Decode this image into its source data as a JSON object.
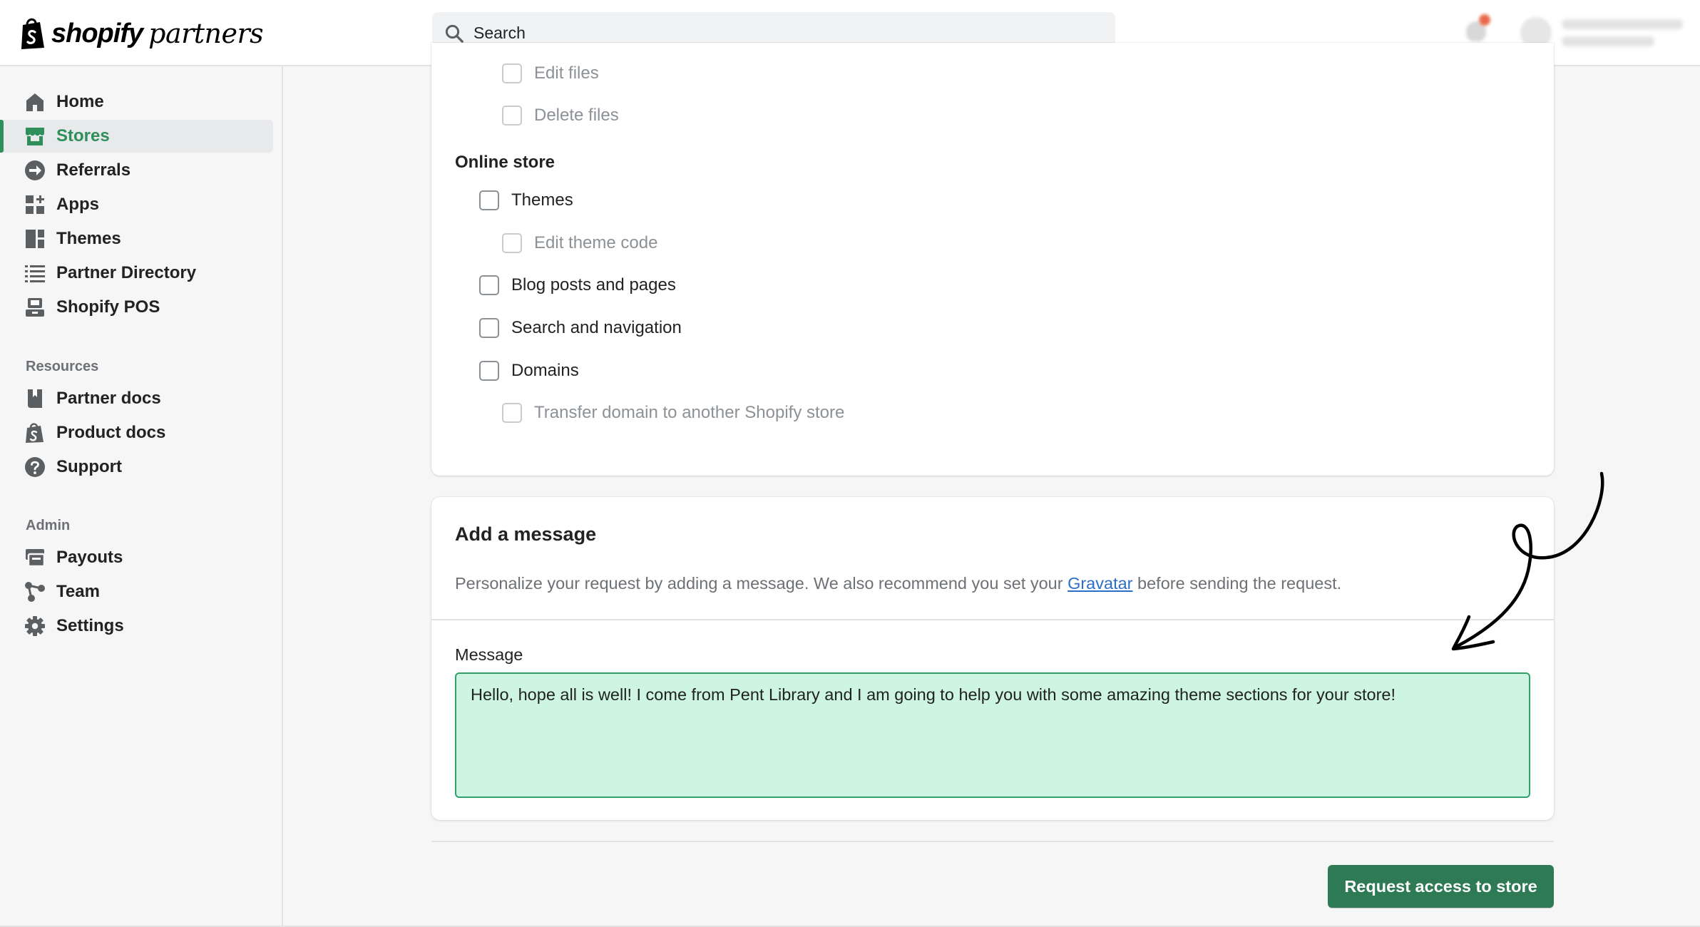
{
  "topbar": {
    "logo_brand": "shopify",
    "logo_product": "partners",
    "search_placeholder": "Search"
  },
  "sidebar": {
    "main_items": [
      {
        "label": "Home",
        "icon": "home-icon"
      },
      {
        "label": "Stores",
        "icon": "store-icon",
        "active": true
      },
      {
        "label": "Referrals",
        "icon": "referrals-icon"
      },
      {
        "label": "Apps",
        "icon": "apps-icon"
      },
      {
        "label": "Themes",
        "icon": "themes-icon"
      },
      {
        "label": "Partner Directory",
        "icon": "list-icon"
      },
      {
        "label": "Shopify POS",
        "icon": "pos-icon"
      }
    ],
    "resources_heading": "Resources",
    "resources_items": [
      {
        "label": "Partner docs",
        "icon": "book-icon"
      },
      {
        "label": "Product docs",
        "icon": "shopify-bag-icon"
      },
      {
        "label": "Support",
        "icon": "question-icon"
      }
    ],
    "admin_heading": "Admin",
    "admin_items": [
      {
        "label": "Payouts",
        "icon": "payouts-icon"
      },
      {
        "label": "Team",
        "icon": "team-icon"
      },
      {
        "label": "Settings",
        "icon": "gear-icon"
      }
    ]
  },
  "permissions": {
    "file_items": [
      {
        "label": "Edit files",
        "dim": true
      },
      {
        "label": "Delete files",
        "dim": true
      }
    ],
    "online_store_title": "Online store",
    "online_store_items": [
      {
        "label": "Themes",
        "dim": false
      },
      {
        "label": "Edit theme code",
        "dim": true
      },
      {
        "label": "Blog posts and pages",
        "dim": false
      },
      {
        "label": "Search and navigation",
        "dim": false
      },
      {
        "label": "Domains",
        "dim": false
      },
      {
        "label": "Transfer domain to another Shopify store",
        "dim": true
      }
    ]
  },
  "message_card": {
    "title": "Add a message",
    "description_before": "Personalize your request by adding a message. We also recommend you set your ",
    "description_link": "Gravatar",
    "description_after": " before sending the request.",
    "message_label": "Message",
    "message_value": "Hello, hope all is well! I come from Pent Library and I am going to help you with some amazing theme sections for your store!"
  },
  "actions": {
    "request_button": "Request access to store"
  },
  "colors": {
    "accent": "#2e8f5b",
    "button": "#2d7a54",
    "message_bg": "#cdf5e1",
    "message_border": "#33a06a",
    "link": "#2c6ecb"
  }
}
